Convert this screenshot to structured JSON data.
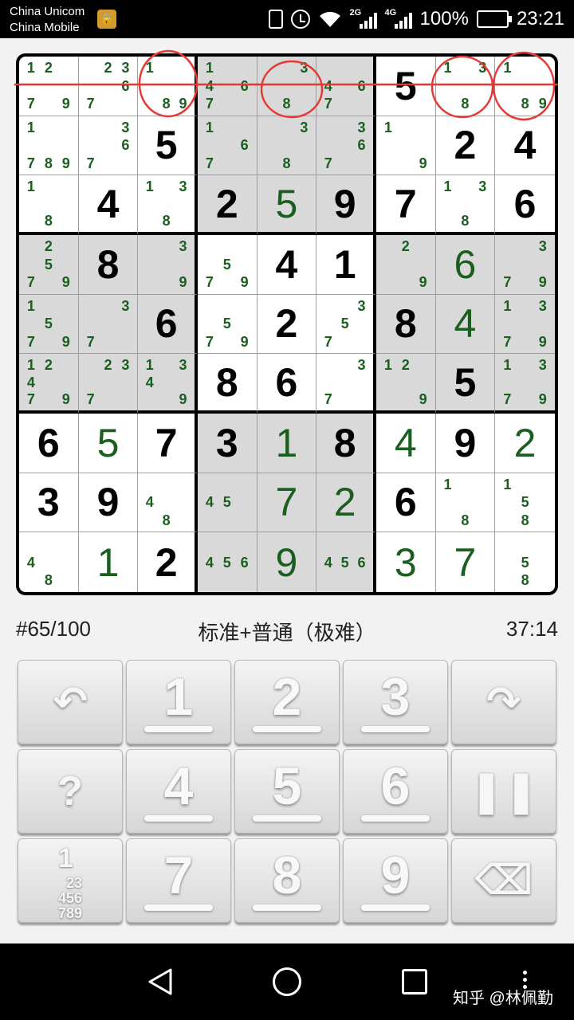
{
  "status_bar": {
    "carrier_1": "China Unicom",
    "carrier_2": "China Mobile",
    "network_1": "2G",
    "network_2": "4G",
    "battery": "100%",
    "time": "23:21"
  },
  "board": {
    "grid": [
      [
        {
          "c": [
            1,
            2,
            7,
            9
          ]
        },
        {
          "c": [
            2,
            3,
            6,
            7
          ]
        },
        {
          "c": [
            1,
            8,
            9
          ]
        },
        {
          "c": [
            1,
            4,
            6,
            7
          ]
        },
        {
          "c": [
            3,
            8
          ]
        },
        {
          "c": [
            4,
            6,
            7
          ]
        },
        {
          "g": 5
        },
        {
          "c": [
            1,
            3,
            8
          ]
        },
        {
          "c": [
            1,
            8,
            9
          ]
        }
      ],
      [
        {
          "c": [
            1,
            7,
            8,
            9
          ]
        },
        {
          "c": [
            3,
            6,
            7
          ]
        },
        {
          "g": 5
        },
        {
          "c": [
            1,
            6,
            7
          ]
        },
        {
          "c": [
            3,
            8
          ]
        },
        {
          "c": [
            3,
            6,
            7
          ]
        },
        {
          "c": [
            1,
            9
          ]
        },
        {
          "g": 2
        },
        {
          "g": 4
        }
      ],
      [
        {
          "c": [
            1,
            8
          ]
        },
        {
          "g": 4
        },
        {
          "c": [
            1,
            3,
            8
          ]
        },
        {
          "g": 2
        },
        {
          "e": 5
        },
        {
          "g": 9
        },
        {
          "g": 7
        },
        {
          "c": [
            1,
            3,
            8
          ]
        },
        {
          "g": 6
        }
      ],
      [
        {
          "c": [
            2,
            5,
            7,
            9
          ]
        },
        {
          "g": 8
        },
        {
          "c": [
            3,
            9
          ]
        },
        {
          "c": [
            5,
            7,
            9
          ]
        },
        {
          "g": 4
        },
        {
          "g": 1
        },
        {
          "c": [
            2,
            9
          ]
        },
        {
          "e": 6
        },
        {
          "c": [
            3,
            7,
            9
          ]
        }
      ],
      [
        {
          "c": [
            1,
            5,
            7,
            9
          ]
        },
        {
          "c": [
            3,
            7
          ]
        },
        {
          "g": 6
        },
        {
          "c": [
            5,
            7,
            9
          ]
        },
        {
          "g": 2
        },
        {
          "c": [
            3,
            5,
            7
          ]
        },
        {
          "g": 8
        },
        {
          "e": 4
        },
        {
          "c": [
            1,
            3,
            7,
            9
          ]
        }
      ],
      [
        {
          "c": [
            1,
            2,
            4,
            7,
            9
          ]
        },
        {
          "c": [
            2,
            3,
            7
          ]
        },
        {
          "c": [
            1,
            3,
            4,
            9
          ]
        },
        {
          "g": 8
        },
        {
          "g": 6
        },
        {
          "c": [
            3,
            7
          ]
        },
        {
          "c": [
            1,
            2,
            9
          ]
        },
        {
          "g": 5
        },
        {
          "c": [
            1,
            3,
            7,
            9
          ]
        }
      ],
      [
        {
          "g": 6
        },
        {
          "e": 5
        },
        {
          "g": 7
        },
        {
          "g": 3
        },
        {
          "e": 1
        },
        {
          "g": 8
        },
        {
          "e": 4
        },
        {
          "g": 9
        },
        {
          "e": 2
        }
      ],
      [
        {
          "g": 3
        },
        {
          "g": 9
        },
        {
          "c": [
            4,
            8
          ]
        },
        {
          "c": [
            4,
            5
          ]
        },
        {
          "e": 7
        },
        {
          "e": 2
        },
        {
          "g": 6
        },
        {
          "c": [
            1,
            8
          ]
        },
        {
          "c": [
            1,
            5,
            8
          ]
        }
      ],
      [
        {
          "c": [
            4,
            8
          ]
        },
        {
          "e": 1
        },
        {
          "g": 2
        },
        {
          "c": [
            4,
            5,
            6
          ]
        },
        {
          "e": 9
        },
        {
          "c": [
            4,
            5,
            6
          ]
        },
        {
          "e": 3
        },
        {
          "e": 7
        },
        {
          "c": [
            5,
            8
          ]
        }
      ]
    ],
    "shaded_boxes": [
      1,
      3,
      5,
      7
    ],
    "annotation_color": "#e53935",
    "given_color": "#000000",
    "entered_color": "#1b5e20"
  },
  "info": {
    "puzzle_number": "#65/100",
    "mode": "标准+普通（极难）",
    "timer": "37:14"
  },
  "keypad": {
    "keys": [
      {
        "type": "icon",
        "name": "undo-icon",
        "glyph": "↶"
      },
      {
        "type": "digit",
        "label": "1"
      },
      {
        "type": "digit",
        "label": "2"
      },
      {
        "type": "digit",
        "label": "3"
      },
      {
        "type": "icon",
        "name": "redo-icon",
        "glyph": "↷"
      },
      {
        "type": "icon",
        "name": "hint-icon",
        "glyph": "?"
      },
      {
        "type": "digit",
        "label": "4"
      },
      {
        "type": "digit",
        "label": "5"
      },
      {
        "type": "digit",
        "label": "6"
      },
      {
        "type": "icon",
        "name": "pause-icon",
        "glyph": "❚❚"
      },
      {
        "type": "pencil",
        "name": "pencil-mode-icon",
        "big": "1",
        "rows": [
          "23",
          "456",
          "789"
        ]
      },
      {
        "type": "digit",
        "label": "7"
      },
      {
        "type": "digit",
        "label": "8"
      },
      {
        "type": "digit",
        "label": "9"
      },
      {
        "type": "icon",
        "name": "erase-icon",
        "glyph": "⌫"
      }
    ]
  },
  "watermark": "知乎 @林佩勤"
}
